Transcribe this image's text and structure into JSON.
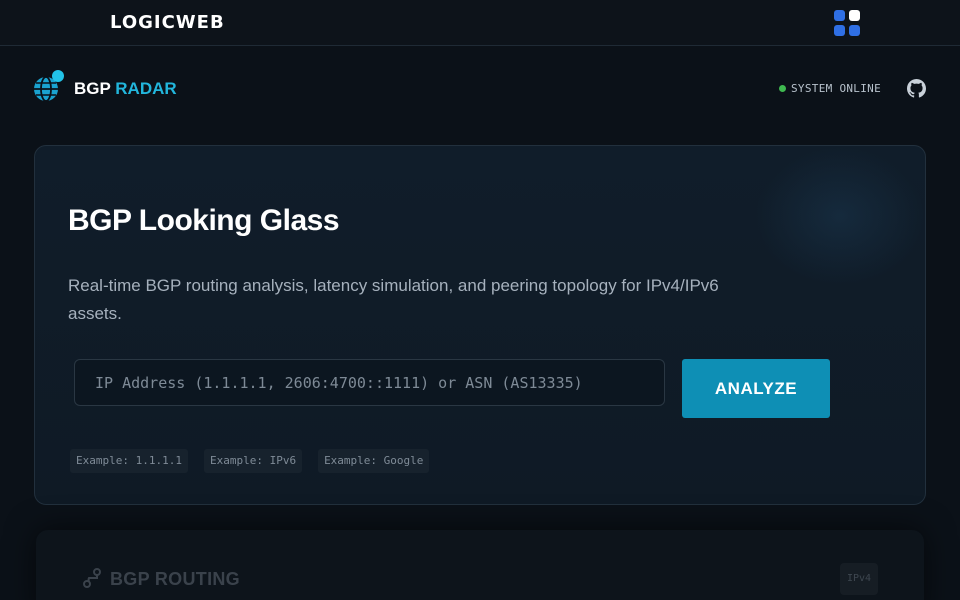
{
  "topbar": {
    "logo": "LOGICWEB",
    "apps_icon": "apps-grid-icon"
  },
  "header": {
    "brand_main": "BGP",
    "brand_accent": "RADAR",
    "status": "SYSTEM ONLINE",
    "status_color": "#3fb950",
    "github_icon": "github-icon"
  },
  "hero": {
    "title": "BGP Looking Glass",
    "subtitle": "Real-time BGP routing analysis, latency simulation, and peering topology for IPv4/IPv6 assets.",
    "search_placeholder": "IP Address (1.1.1.1, 2606:4700::1111) or ASN (AS13335)",
    "search_value": "",
    "analyze_label": "ANALYZE",
    "examples": [
      "Example: 1.1.1.1",
      "Example: IPv6",
      "Example: Google"
    ]
  },
  "routing": {
    "title": "BGP ROUTING",
    "badge": "IPv4"
  },
  "colors": {
    "accent": "#22b6dc",
    "button": "#0e8fb5",
    "background": "#0b1118"
  }
}
